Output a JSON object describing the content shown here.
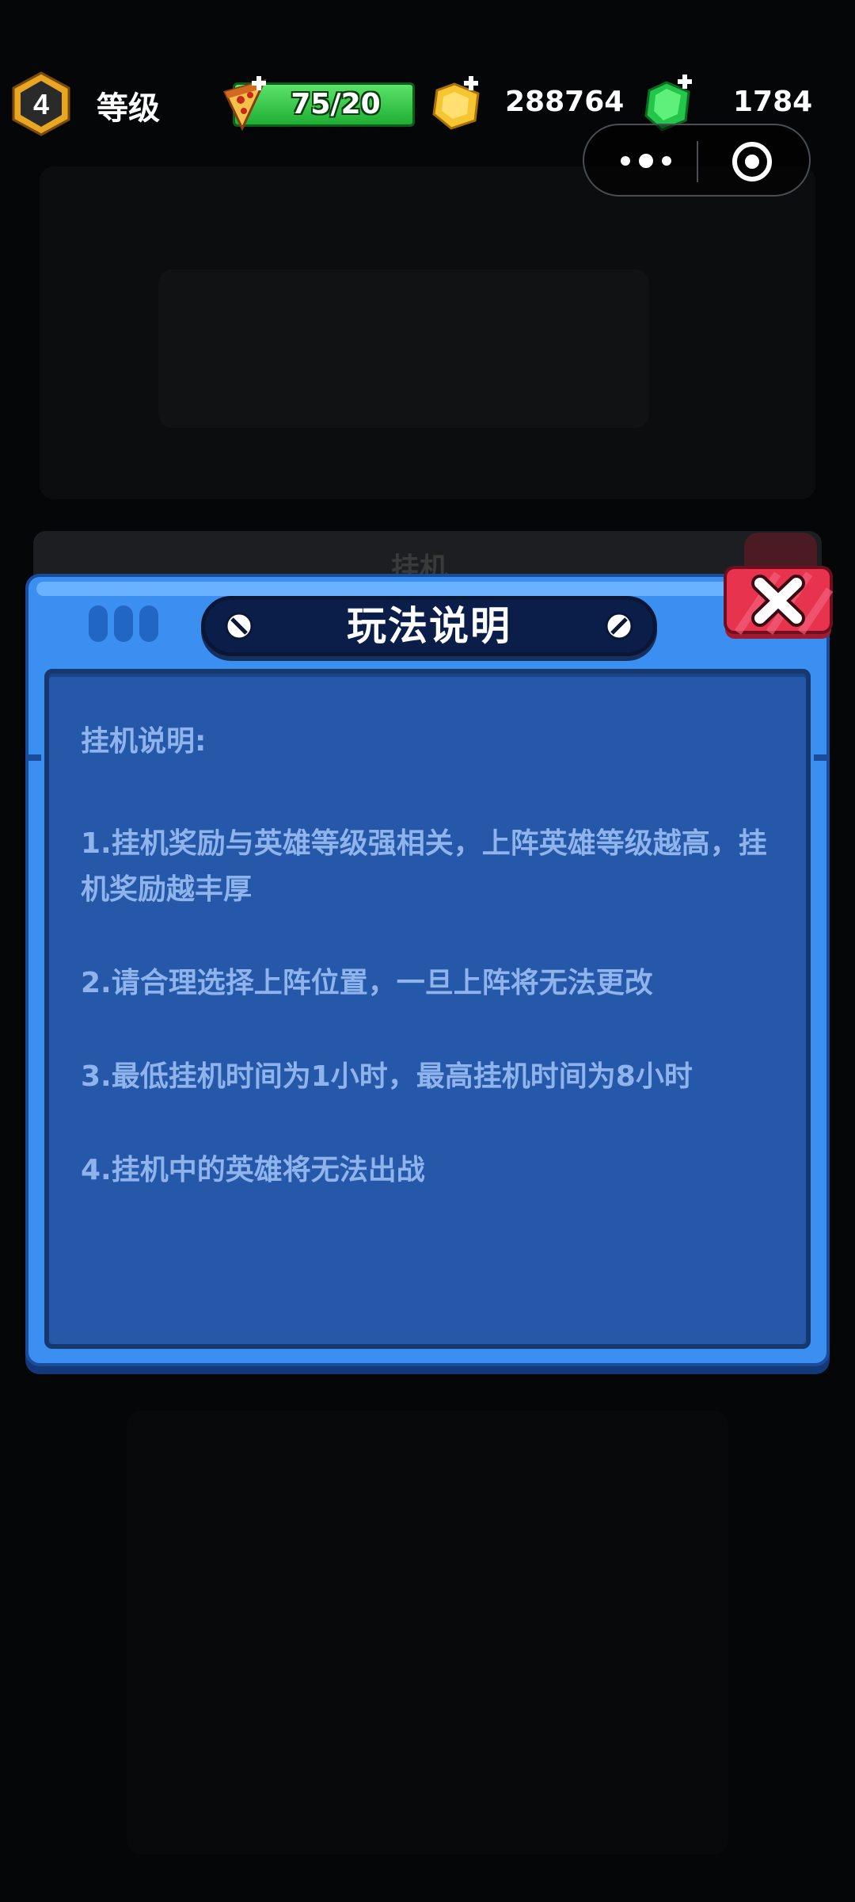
{
  "hud": {
    "level": "4",
    "level_label": "等级",
    "energy_text": "75/20",
    "coins": "288764",
    "gems": "1784"
  },
  "background": {
    "tab_text": "挂机"
  },
  "dialog": {
    "title": "玩法说明",
    "heading": "挂机说明:",
    "rules": [
      "1.挂机奖励与英雄等级强相关，上阵英雄等级越高，挂机奖励越丰厚",
      "2.请合理选择上阵位置，一旦上阵将无法更改",
      "3.最低挂机时间为1小时，最高挂机时间为8小时",
      "4.挂机中的英雄将无法出战"
    ]
  },
  "colors": {
    "dialog_frame": "#3b8ff0",
    "dialog_body": "#2558a8",
    "body_text": "#8fb4ec",
    "title_plate": "#0b1d49",
    "close_button": "#e8334f",
    "energy_bar": "#2fbf3f"
  },
  "icons": {
    "level_badge": "hexagon-level-badge-icon",
    "energy": "pizza-icon",
    "coin": "gold-coin-icon",
    "gem": "green-gem-icon",
    "capsule_more": "more-dots-icon",
    "capsule_close": "target-circle-icon",
    "close": "close-x-icon"
  }
}
